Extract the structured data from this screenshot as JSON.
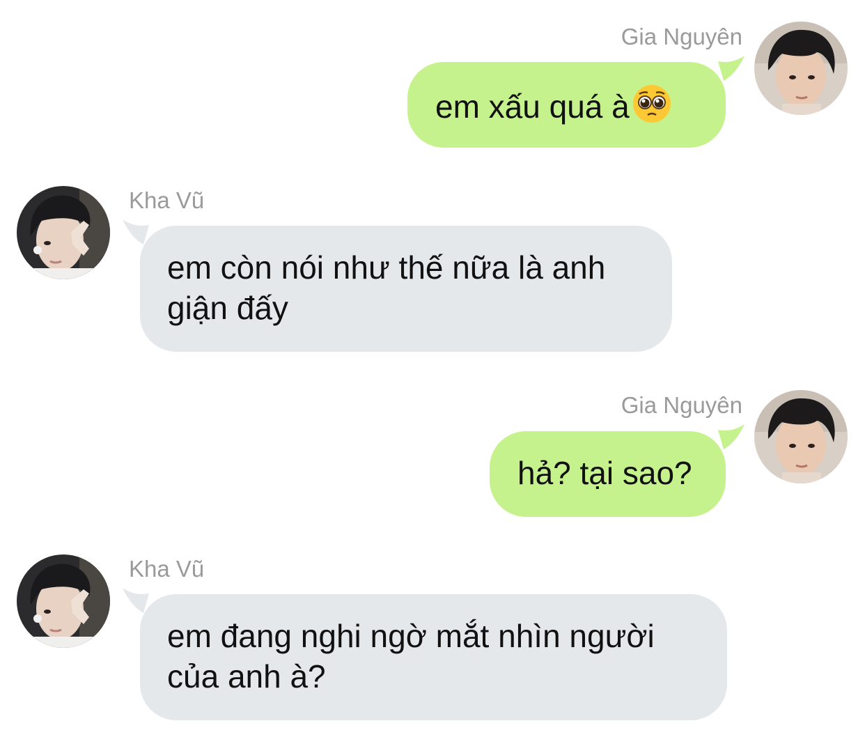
{
  "colors": {
    "outgoing_bubble": "#c6f28d",
    "incoming_bubble": "#e5e8eb",
    "sender_name": "#9a9a9a",
    "message_text": "#111111"
  },
  "messages": [
    {
      "sender": "Gia Nguyên",
      "direction": "outgoing",
      "text": "em xấu quá à",
      "emoji": "pleading-face-icon"
    },
    {
      "sender": "Kha Vũ",
      "direction": "incoming",
      "text_line1": "em còn nói như thế nữa là anh",
      "text_line2": "giận đấy"
    },
    {
      "sender": "Gia Nguyên",
      "direction": "outgoing",
      "text": "hả? tại sao?"
    },
    {
      "sender": "Kha Vũ",
      "direction": "incoming",
      "text_line1": "em đang nghi ngờ mắt nhìn người",
      "text_line2": "của anh à?"
    }
  ]
}
